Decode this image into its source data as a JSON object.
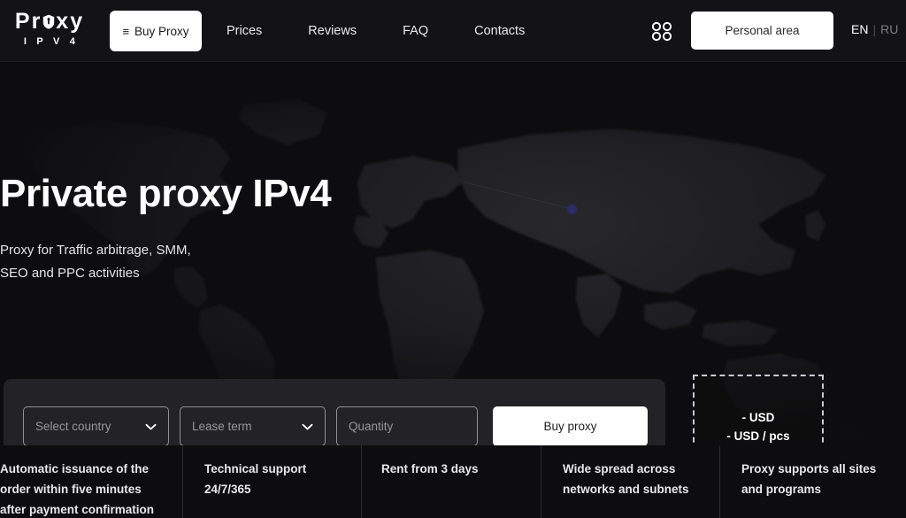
{
  "colors": {
    "page_bg": "#0d0d0f",
    "header_bg": "#131316",
    "panel_bg": "#232327",
    "accent_white": "#ffffff",
    "muted_text": "#95959d",
    "divider": "#2a2a30",
    "map_dot": "#2b2f6e"
  },
  "header": {
    "logo": {
      "word_left": "Pr",
      "shield_icon": "shield-icon",
      "word_right": "xy",
      "subtitle": "I P V 4"
    },
    "buy_proxy_button": {
      "icon": "hamburger-icon",
      "icon_glyph": "≡",
      "label": "Buy Proxy"
    },
    "nav": [
      {
        "label": "Prices"
      },
      {
        "label": "Reviews"
      },
      {
        "label": "FAQ"
      },
      {
        "label": "Contacts"
      }
    ],
    "grid_icon": "grid-2x2-circles-icon",
    "personal_area_button": {
      "label": "Personal area"
    },
    "language": {
      "active": "EN",
      "separator": "|",
      "inactive": "RU"
    }
  },
  "hero": {
    "title": "Private proxy IPv4",
    "subtitle_line1": "Proxy for Traffic arbitrage, SMM,",
    "subtitle_line2": "SEO and PPC activities",
    "background": "world-map-dark"
  },
  "order_form": {
    "country_select": {
      "placeholder": "Select country",
      "value": "",
      "chevron": "chevron-down-icon"
    },
    "lease_select": {
      "placeholder": "Lease term",
      "value": "",
      "chevron": "chevron-down-icon"
    },
    "quantity_input": {
      "placeholder": "Quantity",
      "value": ""
    },
    "submit_button": {
      "label": "Buy proxy"
    }
  },
  "price_box": {
    "total_label": "- USD",
    "unit_label": "- USD / pcs"
  },
  "features": [
    {
      "line1": "Automatic issuance of the",
      "line2": "order within five minutes",
      "line3": "after payment confirmation"
    },
    {
      "line1": "Technical support",
      "line2": "24/7/365",
      "line3": ""
    },
    {
      "line1": "Rent from 3 days",
      "line2": "",
      "line3": ""
    },
    {
      "line1": "Wide spread across",
      "line2": "networks and subnets",
      "line3": ""
    },
    {
      "line1": "Proxy supports all sites",
      "line2": "and programs",
      "line3": ""
    }
  ]
}
